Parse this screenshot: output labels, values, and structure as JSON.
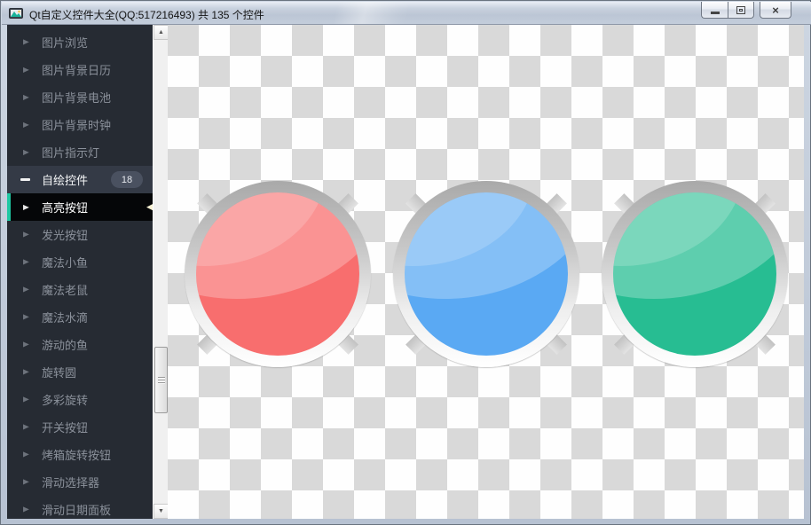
{
  "window": {
    "title": "Qt自定义控件大全(QQ:517216493) 共 135 个控件"
  },
  "glyphs": {
    "collapsed": "▶",
    "selected_pointer": "◀",
    "scroll_up": "▲",
    "scroll_down": "▼",
    "close": "×"
  },
  "sidebar": {
    "items": [
      {
        "label": "图片浏览"
      },
      {
        "label": "图片背景日历"
      },
      {
        "label": "图片背景电池"
      },
      {
        "label": "图片背景时钟"
      },
      {
        "label": "图片指示灯"
      }
    ],
    "parent": {
      "label": "自绘控件",
      "badge": "18"
    },
    "children": [
      {
        "label": "高亮按钮"
      },
      {
        "label": "发光按钮"
      },
      {
        "label": "魔法小鱼"
      },
      {
        "label": "魔法老鼠"
      },
      {
        "label": "魔法水滴"
      },
      {
        "label": "游动的鱼"
      },
      {
        "label": "旋转圆"
      },
      {
        "label": "多彩旋转"
      },
      {
        "label": "开关按钮"
      },
      {
        "label": "烤箱旋转按钮"
      },
      {
        "label": "滑动选择器"
      },
      {
        "label": "滑动日期面板"
      }
    ]
  },
  "content": {
    "buttons": [
      {
        "name": "highlight-button-red",
        "base": "#f86e6e"
      },
      {
        "name": "highlight-button-blue",
        "base": "#5aa9f3"
      },
      {
        "name": "highlight-button-green",
        "base": "#27bd92"
      }
    ],
    "checker": {
      "light": "#fefefe",
      "dark": "#d9d9d9"
    },
    "accent_color": "#1fc8a3",
    "sidebar_bg": "#262b33"
  }
}
